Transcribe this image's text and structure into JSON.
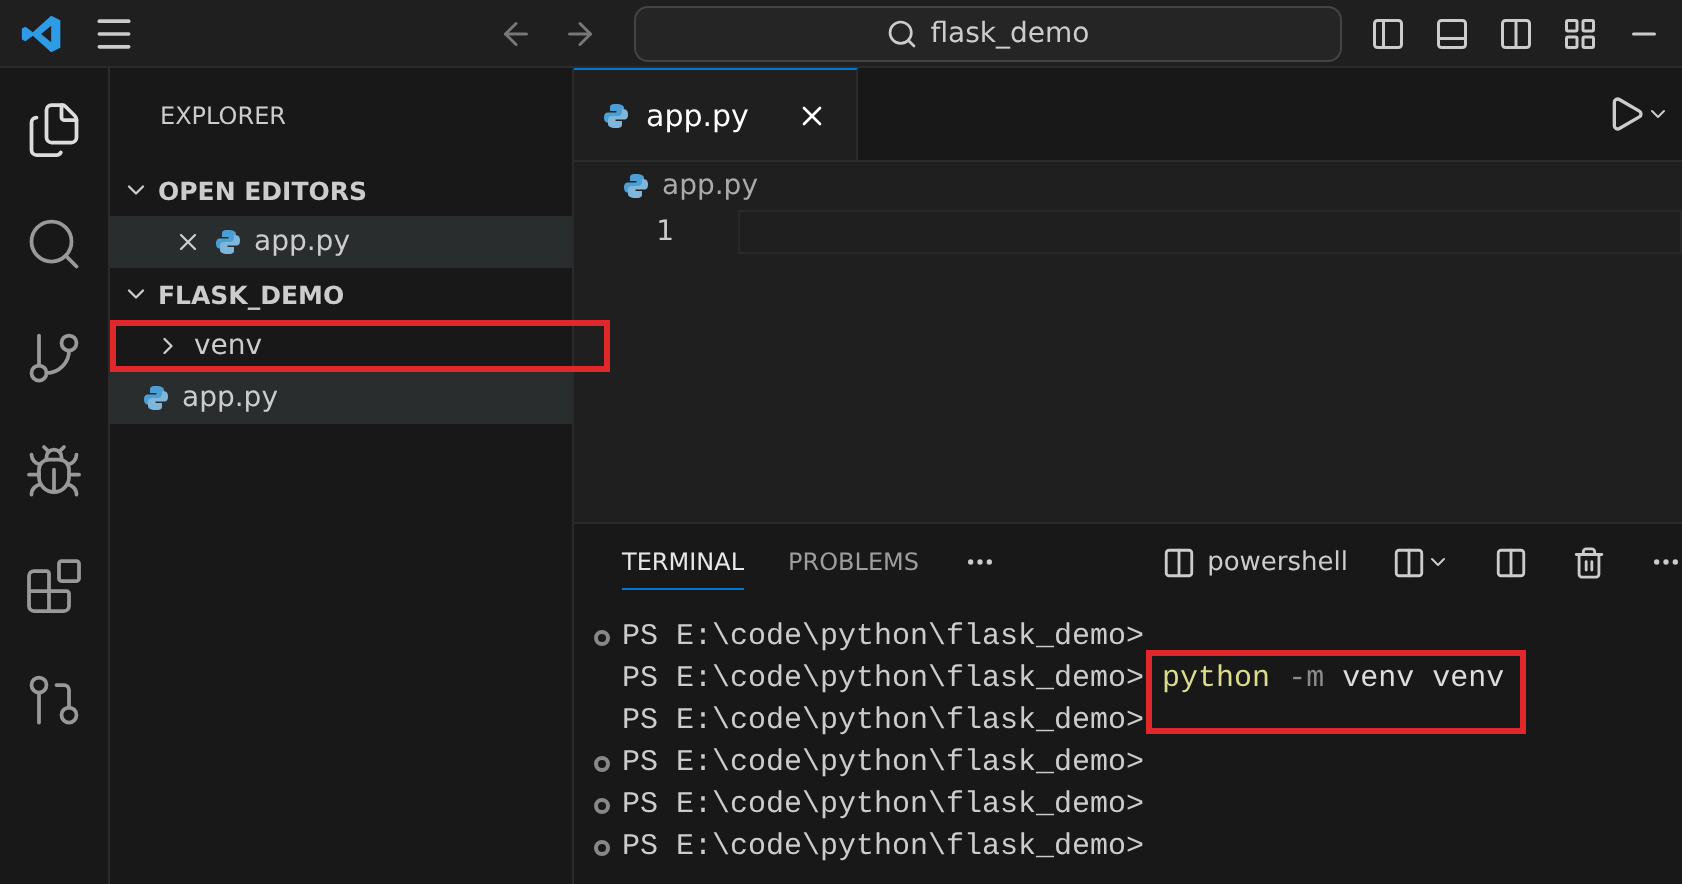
{
  "title_bar": {
    "search": "flask_demo"
  },
  "explorer": {
    "title": "EXPLORER",
    "sections": [
      {
        "label": "OPEN EDITORS",
        "expanded": true,
        "items": [
          {
            "label": "app.py",
            "kind": "editor",
            "selected": true,
            "highlighted": false
          }
        ]
      },
      {
        "label": "FLASK_DEMO",
        "expanded": true,
        "items": [
          {
            "label": "venv",
            "kind": "folder",
            "selected": false,
            "highlighted": true
          },
          {
            "label": "app.py",
            "kind": "file",
            "selected": true,
            "highlighted": false
          }
        ]
      }
    ]
  },
  "editor": {
    "tabs": [
      {
        "label": "app.py",
        "selected": true
      }
    ],
    "breadcrumb": "app.py",
    "line_numbers": [
      "1"
    ]
  },
  "panel": {
    "tabs": [
      {
        "label": "TERMINAL",
        "selected": true
      },
      {
        "label": "PROBLEMS",
        "selected": false
      }
    ],
    "shell": "powershell",
    "lines": [
      {
        "prompt": "PS E:\\code\\python\\flask_demo>",
        "marker": true,
        "highlighted": false
      },
      {
        "prompt": "PS E:\\code\\python\\flask_demo>",
        "marker": false,
        "highlighted": true,
        "tokens": [
          {
            "text": "python",
            "kind": "command"
          },
          {
            "text": "-m",
            "kind": "flag"
          },
          {
            "text": "venv",
            "kind": "arg"
          },
          {
            "text": "venv",
            "kind": "arg"
          }
        ]
      },
      {
        "prompt": "PS E:\\code\\python\\flask_demo>",
        "marker": false,
        "highlighted": false
      },
      {
        "prompt": "PS E:\\code\\python\\flask_demo>",
        "marker": true,
        "highlighted": false
      },
      {
        "prompt": "PS E:\\code\\python\\flask_demo>",
        "marker": true,
        "highlighted": false
      },
      {
        "prompt": "PS E:\\code\\python\\flask_demo>",
        "marker": true,
        "highlighted": false
      }
    ]
  }
}
